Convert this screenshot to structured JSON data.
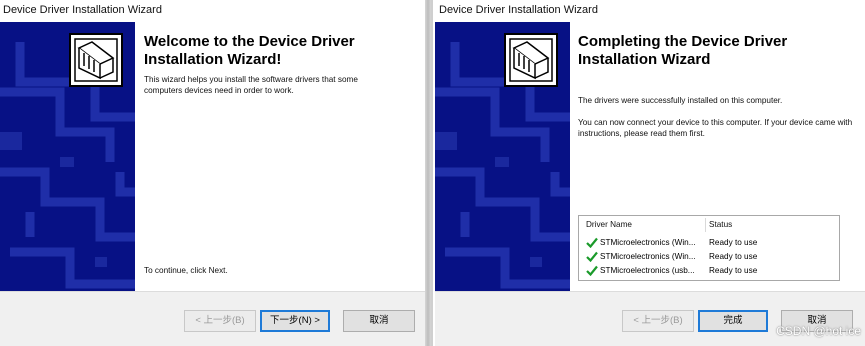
{
  "left_window": {
    "title": "Device Driver Installation Wizard",
    "heading": "Welcome to the Device Driver Installation Wizard!",
    "description": "This wizard helps you install the software drivers that some computers devices need in order to work.",
    "instruction": "To continue, click Next.",
    "buttons": {
      "back": "< 上一步(B)",
      "next": "下一步(N) >",
      "cancel": "取消"
    }
  },
  "right_window": {
    "title": "Device Driver Installation Wizard",
    "heading": "Completing the Device Driver Installation Wizard",
    "success_text": "The drivers were successfully installed on this computer.",
    "connect_text": "You can now connect your device to this computer. If your device came with instructions, please read them first.",
    "table": {
      "columns": [
        "Driver Name",
        "Status"
      ],
      "rows": [
        {
          "name": "STMicroelectronics (Win...",
          "status": "Ready to use",
          "icon": "green-check-icon"
        },
        {
          "name": "STMicroelectronics (Win...",
          "status": "Ready to use",
          "icon": "green-check-icon"
        },
        {
          "name": "STMicroelectronics (usb...",
          "status": "Ready to use",
          "icon": "green-check-icon"
        }
      ]
    },
    "buttons": {
      "back": "< 上一步(B)",
      "finish": "完成",
      "cancel": "取消"
    }
  },
  "watermark": "CSDN @hot ice",
  "colors": {
    "side_panel": "#071185",
    "check": "#1a9a2a",
    "default_button_border": "#1e7ad7"
  }
}
